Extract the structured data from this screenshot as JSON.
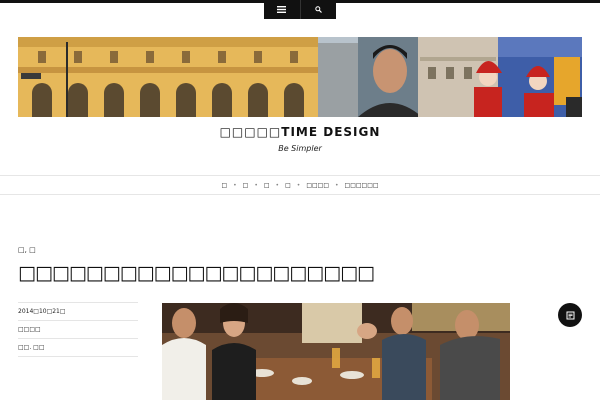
{
  "toolbar": {
    "menu_icon": "menu-icon",
    "search_icon": "search-icon"
  },
  "site": {
    "title": "□□□□□TIME DESIGN",
    "tagline": "Be Simpler"
  },
  "nav": {
    "items": [
      "□",
      "□",
      "□",
      "□",
      "□□□□",
      "□□□□□□"
    ]
  },
  "post": {
    "category": "□, □",
    "title": "□□□□□□□□□□□□□□□□□□□□□",
    "date": "2014□10□21□",
    "author": "□□□□",
    "comments": "□□. □□"
  },
  "floating": {
    "icon": "edit-icon"
  }
}
